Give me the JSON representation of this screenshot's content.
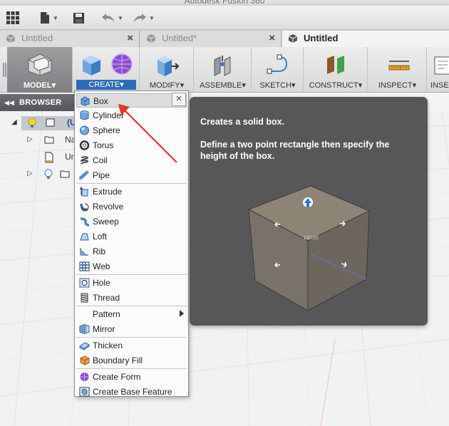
{
  "window": {
    "title": "Autodesk Fusion 360"
  },
  "tabs": [
    {
      "label": "Untitled",
      "active": false
    },
    {
      "label": "Untitled*",
      "active": false
    },
    {
      "label": "Untitled",
      "active": true
    }
  ],
  "ribbon": {
    "model_label": "MODEL▾",
    "create_label": "CREATE▾",
    "modify_label": "MODIFY▾",
    "assemble_label": "ASSEMBLE▾",
    "sketch_label": "SKETCH▾",
    "construct_label": "CONSTRUCT▾",
    "inspect_label": "INSPECT▾",
    "insert_label": "INSE"
  },
  "browser": {
    "header": "BROWSER",
    "rows": [
      {
        "text": "(U"
      },
      {
        "text": "Na"
      },
      {
        "text": "Un"
      }
    ]
  },
  "menu": {
    "items": [
      {
        "label": "Box"
      },
      {
        "label": "Cylinder"
      },
      {
        "label": "Sphere"
      },
      {
        "label": "Torus"
      },
      {
        "label": "Coil"
      },
      {
        "label": "Pipe"
      },
      {
        "label": "Extrude"
      },
      {
        "label": "Revolve"
      },
      {
        "label": "Sweep"
      },
      {
        "label": "Loft"
      },
      {
        "label": "Rib"
      },
      {
        "label": "Web"
      },
      {
        "label": "Hole"
      },
      {
        "label": "Thread"
      },
      {
        "label": "Pattern"
      },
      {
        "label": "Mirror"
      },
      {
        "label": "Thicken"
      },
      {
        "label": "Boundary Fill"
      },
      {
        "label": "Create Form"
      },
      {
        "label": "Create Base Feature"
      }
    ],
    "close_glyph": "×"
  },
  "tooltip": {
    "title": "Creates a solid box.",
    "description": "Define a two point rectangle then specify the height of the box.",
    "dimension": "100.00"
  },
  "colors": {
    "accent": "#2d6bb5",
    "tooltip_bg": "#57575a",
    "annotation_arrow": "#e53226"
  }
}
